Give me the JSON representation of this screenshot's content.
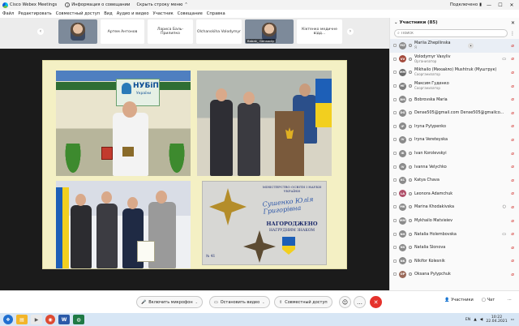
{
  "titlebar": {
    "app_name": "Cisco Webex Meetings",
    "meeting_info": "Информация о совещании",
    "hide_menu": "Скрыть строку меню",
    "connected": "Подключено",
    "min": "—",
    "max": "☐",
    "close": "✕"
  },
  "menubar": {
    "items": [
      "Файл",
      "Редактировать",
      "Совместный доступ",
      "Вид",
      "Аудио и видео",
      "Участник",
      "Совещание",
      "Справка"
    ]
  },
  "strip": {
    "thumbs": [
      "Артем Антонов",
      "Лариса Баль-Прилипко",
      "Olchanskiha Volodymyr",
      "Babak_ Gennadiy",
      "Кіктенко медичне відд..."
    ]
  },
  "controls": {
    "unmute": "Включить микрофон",
    "stop_video": "Остановить видео",
    "share": "Совместный доступ",
    "participants": "Участники",
    "chat": "Чат"
  },
  "panel": {
    "title": "Участники (85)",
    "search_placeholder": "Поиск",
    "participants": [
      {
        "initials": "MZ",
        "name": "Mariia Zhepilinska",
        "role": "Я",
        "color": "#8a8a8a"
      },
      {
        "initials": "VV",
        "name": "Volodymyr Vasyliv",
        "role": "Организатор",
        "color": "#a34a3c"
      },
      {
        "initials": "MM",
        "name": "Mikhailo (Михайло) Mushtruk (Муштрук)",
        "role": "Соорганизатор",
        "color": "#6b6b6b"
      },
      {
        "initials": "МГ",
        "name": "Максим Гуденко",
        "role": "Соорганизатор",
        "color": "#7d7d7d"
      },
      {
        "initials": "BM",
        "name": "Bobrovska Maria",
        "role": "",
        "color": "#8a8a8a"
      },
      {
        "initials": "DG",
        "name": "Dense505@gmail.com Dense505@gmailco...",
        "role": "",
        "color": "#8a8a8a"
      },
      {
        "initials": "IP",
        "name": "Iryna Pylypenko",
        "role": "",
        "color": "#8a8a8a"
      },
      {
        "initials": "IV",
        "name": "Iryna Vereteyska",
        "role": "",
        "color": "#8a8a8a"
      },
      {
        "initials": "IK",
        "name": "Ivan Korolevskyi",
        "role": "",
        "color": "#8a8a8a"
      },
      {
        "initials": "IV",
        "name": "Ivanna Velychko",
        "role": "",
        "color": "#8a8a8a"
      },
      {
        "initials": "KC",
        "name": "Katya Chava",
        "role": "",
        "color": "#8a8a8a"
      },
      {
        "initials": "LA",
        "name": "Leonora Adamchuk",
        "role": "",
        "color": "#b0506a"
      },
      {
        "initials": "MK",
        "name": "Marina Khodakivska",
        "role": "",
        "color": "#8a8a8a"
      },
      {
        "initials": "MM",
        "name": "Mykhailo Matvieiev",
        "role": "",
        "color": "#8a8a8a"
      },
      {
        "initials": "NH",
        "name": "Natalia Holembovska",
        "role": "",
        "color": "#8a8a8a"
      },
      {
        "initials": "NS",
        "name": "Natalia Slonova",
        "role": "",
        "color": "#8a8a8a"
      },
      {
        "initials": "NK",
        "name": "Nikifor Kolesnik",
        "role": "",
        "color": "#8a8a8a"
      },
      {
        "initials": "OP",
        "name": "Oksana Pylypchuk",
        "role": "",
        "color": "#9a6a5a"
      }
    ]
  },
  "slide": {
    "nubip": "НУБіП",
    "nubip_sub": "України",
    "cert_ministry": "МІНІСТЕРСТВО ОСВІТИ І НАУКИ УКРАЇНИ",
    "cert_name": "Сушенко Юлія Григорівна",
    "cert_awarded": "НАГОРОДЖЕНО",
    "cert_badge": "НАГРУДНИМ ЗНАКОМ",
    "cert_number": "№ 41"
  },
  "taskbar": {
    "lang": "EN",
    "time": "10:22",
    "date": "22.04.2021"
  }
}
